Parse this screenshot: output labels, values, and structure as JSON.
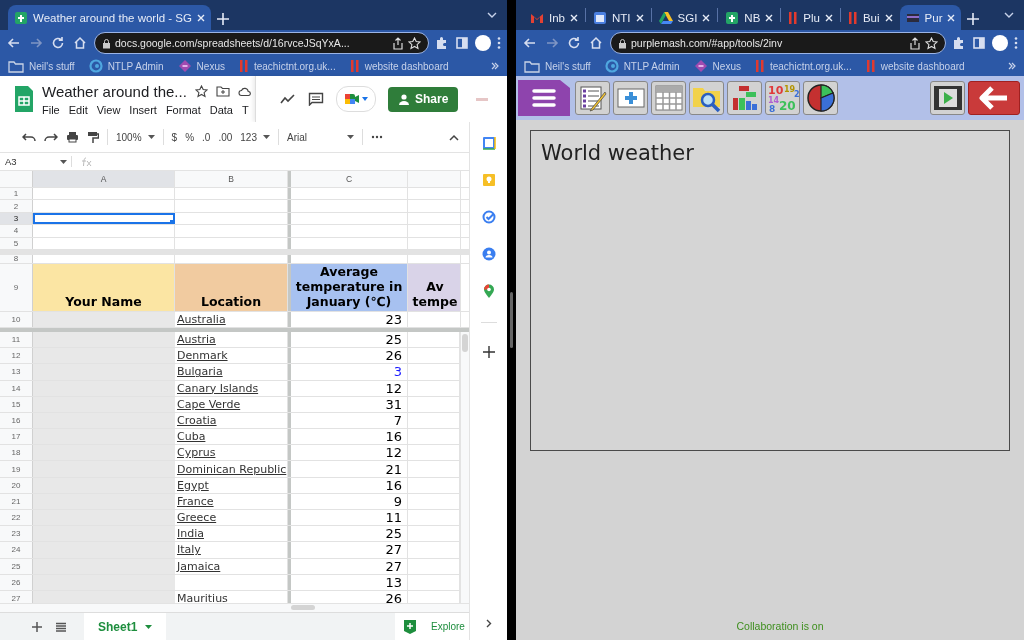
{
  "left_browser": {
    "tabs": [
      {
        "title": "Weather around the world - SG",
        "kind": "sheets",
        "selected": true
      }
    ],
    "url": "docs.google.com/spreadsheets/d/16rvceJSqYxA...",
    "bookmarks": [
      {
        "label": "Neil's stuff",
        "kind": "folder"
      },
      {
        "label": "NTLP Admin",
        "kind": "globe"
      },
      {
        "label": "Nexus",
        "kind": "diamond"
      },
      {
        "label": "teachictnt.org.uk...",
        "kind": "bars"
      },
      {
        "label": "website dashboard",
        "kind": "bars"
      }
    ]
  },
  "sheet": {
    "title": "Weather around the...",
    "menus": [
      "File",
      "Edit",
      "View",
      "Insert",
      "Format",
      "Data",
      "T"
    ],
    "share": "Share",
    "toolbar": {
      "zoom": "100%",
      "currency": "$",
      "percent": "%",
      "decrease_decimal": ".0",
      "increase_decimal": ".00",
      "number_format": "123",
      "font": "Arial"
    },
    "name_box": "A3",
    "columns": [
      {
        "label": "A",
        "selected": true
      },
      {
        "label": "B",
        "selected": false
      },
      {
        "label": "C",
        "selected": false
      }
    ],
    "top_rows": [
      {
        "num": "1",
        "selected": false
      },
      {
        "num": "2",
        "selected": false
      },
      {
        "num": "3",
        "selected": true
      },
      {
        "num": "4",
        "selected": false
      },
      {
        "num": "5",
        "selected": false
      },
      {
        "num": "8",
        "selected": false
      }
    ],
    "header_row": {
      "num": "9",
      "cells": [
        {
          "text": "Your Name",
          "color": "#fbe5a3"
        },
        {
          "text": "Location",
          "color": "#f1cba0"
        },
        {
          "text": "Average temperature in January (℃)",
          "color": "#a7c1f0"
        },
        {
          "text": "Av tempe",
          "color": "#d9d3e8"
        }
      ]
    },
    "rows": [
      {
        "num": "10",
        "location": "Australia",
        "value": "23",
        "color": "#000000"
      },
      {
        "num": "11",
        "location": "Austria",
        "value": "25",
        "color": "#000000"
      },
      {
        "num": "12",
        "location": "Denmark",
        "value": "26",
        "color": "#000000"
      },
      {
        "num": "13",
        "location": "Bulgaria",
        "value": "3",
        "color": "#1a1aff"
      },
      {
        "num": "14",
        "location": "Canary Islands",
        "value": "12",
        "color": "#000000"
      },
      {
        "num": "15",
        "location": "Cape Verde",
        "value": "31",
        "color": "#000000"
      },
      {
        "num": "16",
        "location": "Croatia",
        "value": "7",
        "color": "#000000"
      },
      {
        "num": "17",
        "location": "Cuba",
        "value": "16",
        "color": "#000000"
      },
      {
        "num": "18",
        "location": "Cyprus",
        "value": "12",
        "color": "#000000"
      },
      {
        "num": "19",
        "location": "Dominican Republic",
        "value": "21",
        "color": "#000000"
      },
      {
        "num": "20",
        "location": "Egypt",
        "value": "16",
        "color": "#000000"
      },
      {
        "num": "21",
        "location": "France",
        "value": "9",
        "color": "#000000"
      },
      {
        "num": "22",
        "location": "Greece",
        "value": "11",
        "color": "#000000"
      },
      {
        "num": "23",
        "location": "India",
        "value": "25",
        "color": "#000000"
      },
      {
        "num": "24",
        "location": "Italy",
        "value": "27",
        "color": "#000000"
      },
      {
        "num": "25",
        "location": "Jamaica",
        "value": "27",
        "color": "#000000"
      },
      {
        "num": "26",
        "value": "13",
        "color": "#000000"
      },
      {
        "num": "27",
        "location": "Mauritius",
        "value": "26",
        "color": "#000000"
      }
    ],
    "sheet_tabs": [
      {
        "label": "Sheet1",
        "selected": true
      }
    ],
    "explore": "Explore"
  },
  "right_browser": {
    "tabs": [
      {
        "title": "Inb",
        "kind": "mail",
        "selected": false
      },
      {
        "title": "NTI",
        "kind": "calendar",
        "selected": false
      },
      {
        "title": "SGI",
        "kind": "drive",
        "selected": false
      },
      {
        "title": "NB",
        "kind": "sheets",
        "selected": false
      },
      {
        "title": "Plu",
        "kind": "bars",
        "selected": false
      },
      {
        "title": "Bui",
        "kind": "bars",
        "selected": false
      },
      {
        "title": "Pur",
        "kind": "purple",
        "selected": true
      }
    ],
    "url": "purplemash.com/#app/tools/2inv",
    "bookmarks": [
      {
        "label": "Neil's stuff",
        "kind": "folder"
      },
      {
        "label": "NTLP Admin",
        "kind": "globe"
      },
      {
        "label": "Nexus",
        "kind": "diamond"
      },
      {
        "label": "teachictnt.org.uk...",
        "kind": "bars"
      },
      {
        "label": "website dashboard",
        "kind": "bars"
      }
    ]
  },
  "purple_mash": {
    "numbers_tool": [
      {
        "text": "10",
        "color": "#e03a3a"
      },
      {
        "text": "19",
        "color": "#b39400"
      },
      {
        "text": "2",
        "color": "#3a6fd8"
      },
      {
        "text": "14",
        "color": "#b05fd0"
      },
      {
        "text": "8",
        "color": "#3a6fd8"
      },
      {
        "text": "20",
        "color": "#3cc05a"
      }
    ],
    "panel_title": "World weather",
    "status": "Collaboration is on"
  }
}
